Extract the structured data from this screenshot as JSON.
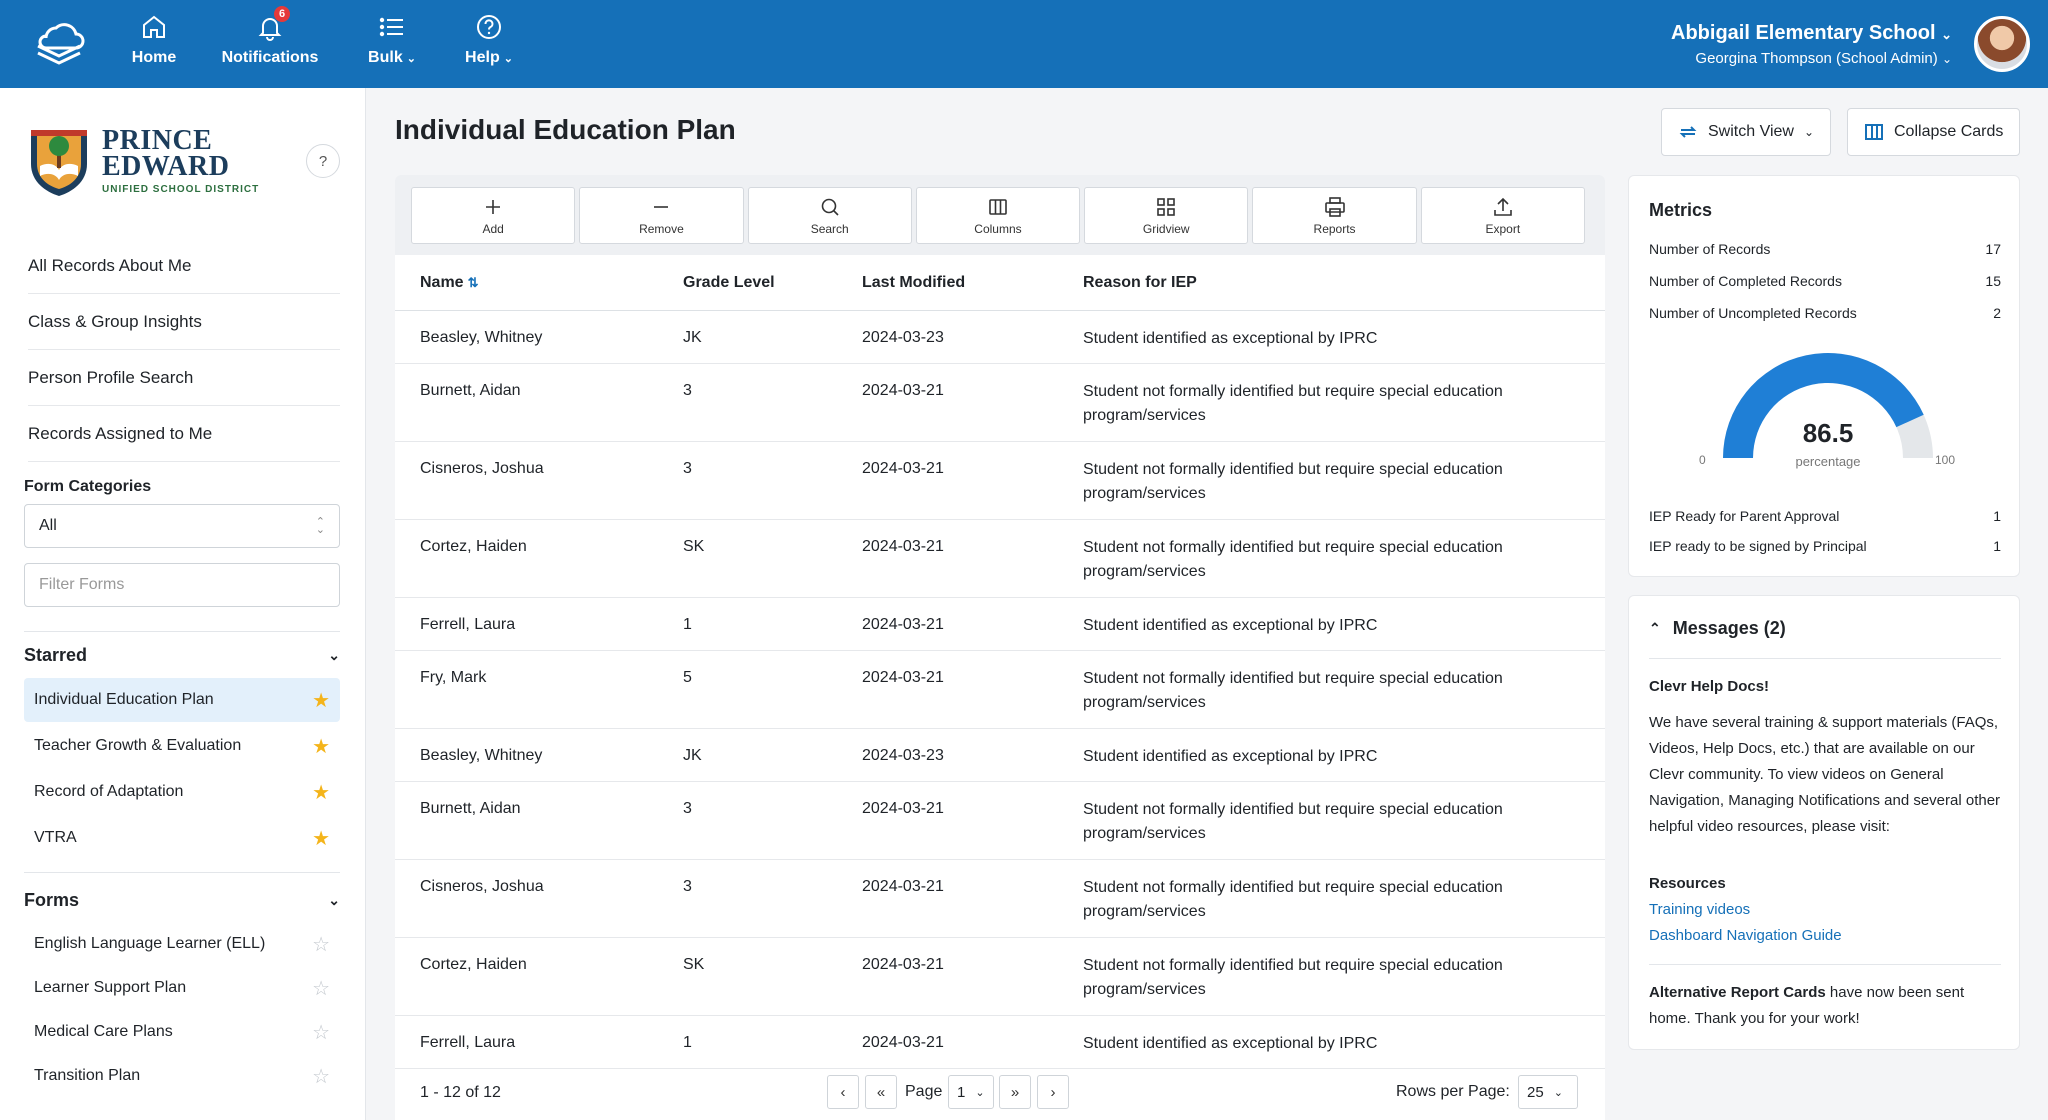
{
  "nav": {
    "home": "Home",
    "notifications": "Notifications",
    "notifications_count": "6",
    "bulk": "Bulk",
    "help": "Help",
    "school_name": "Abbigail Elementary School",
    "user": "Georgina Thompson (School Admin)"
  },
  "brand": {
    "line1": "PRINCE",
    "line2": "EDWARD",
    "line3": "UNIFIED SCHOOL DISTRICT",
    "help": "?"
  },
  "sidebar": {
    "links": [
      "All Records About Me",
      "Class & Group Insights",
      "Person Profile Search",
      "Records Assigned to Me"
    ],
    "form_categories_label": "Form Categories",
    "category_value": "All",
    "filter_placeholder": "Filter Forms",
    "starred_title": "Starred",
    "starred": [
      "Individual Education Plan",
      "Teacher Growth & Evaluation",
      "Record of Adaptation",
      "VTRA"
    ],
    "forms_title": "Forms",
    "forms": [
      "English Language Learner (ELL)",
      "Learner Support Plan",
      "Medical Care Plans",
      "Transition Plan"
    ]
  },
  "page": {
    "title": "Individual Education Plan",
    "switch_view": "Switch View",
    "collapse_cards": "Collapse Cards"
  },
  "toolbar": [
    "Add",
    "Remove",
    "Search",
    "Columns",
    "Gridview",
    "Reports",
    "Export"
  ],
  "table": {
    "headers": [
      "Name",
      "Grade Level",
      "Last Modified",
      "Reason for IEP"
    ],
    "rows": [
      [
        "Beasley, Whitney",
        "JK",
        "2024-03-23",
        "Student identified as exceptional by IPRC"
      ],
      [
        "Burnett, Aidan",
        "3",
        "2024-03-21",
        "Student not formally identified but require special education program/services"
      ],
      [
        "Cisneros, Joshua",
        "3",
        "2024-03-21",
        "Student not formally identified but require special education program/services"
      ],
      [
        "Cortez, Haiden",
        "SK",
        "2024-03-21",
        "Student not formally identified but require special education program/services"
      ],
      [
        "Ferrell, Laura",
        "1",
        "2024-03-21",
        "Student identified as exceptional by IPRC"
      ],
      [
        "Fry, Mark",
        "5",
        "2024-03-21",
        "Student not formally identified but require special education program/services"
      ],
      [
        "Beasley, Whitney",
        "JK",
        "2024-03-23",
        "Student identified as exceptional by IPRC"
      ],
      [
        "Burnett, Aidan",
        "3",
        "2024-03-21",
        "Student not formally identified but require special education program/services"
      ],
      [
        "Cisneros, Joshua",
        "3",
        "2024-03-21",
        "Student not formally identified but require special education program/services"
      ],
      [
        "Cortez, Haiden",
        "SK",
        "2024-03-21",
        "Student not formally identified but require special education program/services"
      ],
      [
        "Ferrell, Laura",
        "1",
        "2024-03-21",
        "Student identified as exceptional by IPRC"
      ]
    ]
  },
  "pager": {
    "count": "1 - 12 of 12",
    "page_label": "Page",
    "page_value": "1",
    "rows_label": "Rows per Page:",
    "rows_value": "25"
  },
  "metrics": {
    "title": "Metrics",
    "items": [
      {
        "label": "Number of Records",
        "value": "17"
      },
      {
        "label": "Number of Completed Records",
        "value": "15"
      },
      {
        "label": "Number of Uncompleted Records",
        "value": "2"
      }
    ],
    "gauge_value": "86.5",
    "gauge_fraction": 0.865,
    "gauge_caption": "percentage",
    "gauge_min": "0",
    "gauge_max": "100",
    "extra": [
      {
        "label": "IEP Ready for Parent Approval",
        "value": "1"
      },
      {
        "label": "IEP ready to be signed by Principal",
        "value": "1"
      }
    ],
    "gauge_color": "#1f7fd6"
  },
  "messages": {
    "title": "Messages (2)",
    "m1_title": "Clevr Help Docs!",
    "m1_body": "We have several training & support materials (FAQs, Videos, Help Docs, etc.) that are available on our Clevr community. To view videos on General Navigation, Managing Notifications and several other helpful video resources, please visit:",
    "resources_title": "Resources",
    "link1": "Training videos",
    "link2": "Dashboard Navigation Guide",
    "m2_bold": "Alternative Report Cards",
    "m2_rest": " have now been sent home. Thank you for your work!"
  }
}
